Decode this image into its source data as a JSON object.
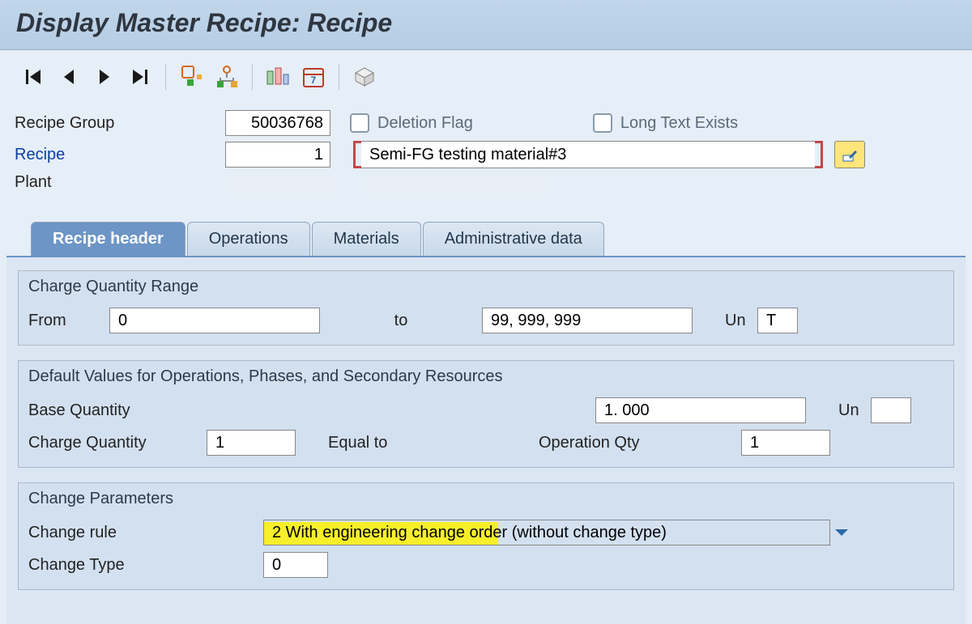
{
  "title": "Display Master Recipe: Recipe",
  "toolbar": {
    "first_icon": "first-icon",
    "prev_icon": "prev-icon",
    "next_icon": "next-icon",
    "last_icon": "last-icon"
  },
  "header": {
    "recipe_group_label": "Recipe Group",
    "recipe_group_value": "50036768",
    "deletion_flag_label": "Deletion Flag",
    "long_text_label": "Long Text Exists",
    "recipe_label": "Recipe",
    "recipe_value": "1",
    "description": "Semi-FG testing material#3",
    "plant_label": "Plant"
  },
  "tabs": {
    "recipe_header": "Recipe header",
    "operations": "Operations",
    "materials": "Materials",
    "admin": "Administrative data"
  },
  "charge_range": {
    "title": "Charge Quantity Range",
    "from_label": "From",
    "from_value": "0",
    "to_label": "to",
    "to_value": "99, 999, 999",
    "unit_label": "Un",
    "unit_value": "T"
  },
  "defaults": {
    "title": "Default Values for Operations, Phases, and Secondary Resources",
    "base_qty_label": "Base Quantity",
    "base_qty_value": "1. 000",
    "unit_label": "Un",
    "charge_qty_label": "Charge Quantity",
    "charge_qty_value": "1",
    "equal_to_label": "Equal to",
    "op_qty_label": "Operation Qty",
    "op_qty_value": "1"
  },
  "change_params": {
    "title": "Change Parameters",
    "change_rule_label": "Change rule",
    "change_rule_value": "2 With engineering change order (without change type)",
    "change_type_label": "Change Type",
    "change_type_value": "0"
  }
}
